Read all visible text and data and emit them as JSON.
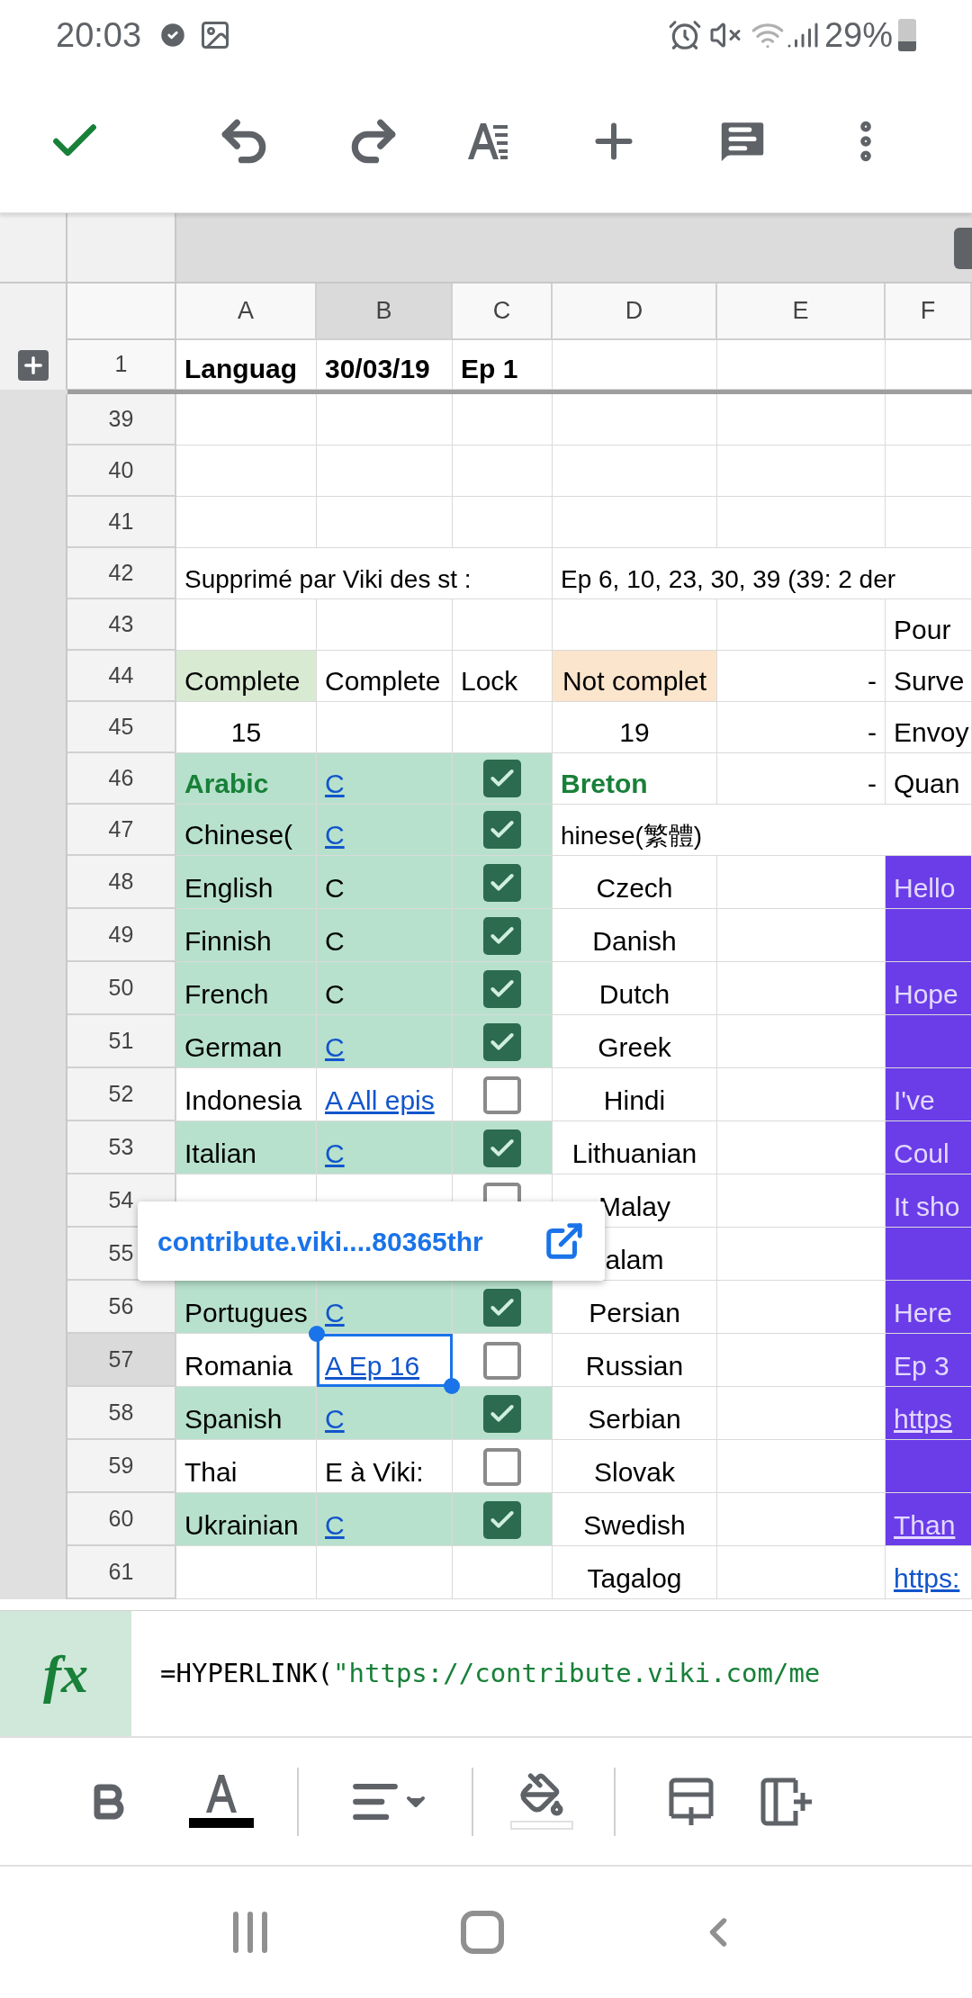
{
  "status_bar": {
    "time": "20:03",
    "battery": "29%"
  },
  "columns": [
    {
      "label": "A",
      "selected": false
    },
    {
      "label": "B",
      "selected": true
    },
    {
      "label": "C",
      "selected": false
    },
    {
      "label": "D",
      "selected": false
    },
    {
      "label": "E",
      "selected": false
    },
    {
      "label": "F",
      "selected": false
    }
  ],
  "frozen_row": {
    "number": "1",
    "cells": [
      {
        "text": "Languag",
        "kind": "header"
      },
      {
        "text": "30/03/19",
        "kind": "header"
      },
      {
        "text": "Ep 1",
        "kind": "header"
      }
    ]
  },
  "rows": [
    {
      "number": "39",
      "selected": false
    },
    {
      "number": "40",
      "selected": false
    },
    {
      "number": "41",
      "selected": false
    },
    {
      "number": "42",
      "selected": false,
      "cells": [
        {
          "text": "Supprimé par Viki des st :",
          "kind": "overflow"
        },
        {},
        {},
        {
          "text": "Ep 6, 10, 23, 30, 39 (39: 2 der",
          "kind": "overflow"
        }
      ]
    },
    {
      "number": "43",
      "selected": false,
      "cells": [
        {},
        {},
        {},
        {},
        {},
        {
          "text": "Pour",
          "kind": "text"
        }
      ]
    },
    {
      "number": "44",
      "selected": false,
      "cells": [
        {
          "text": "Complete",
          "kind": "text",
          "color": "#d9ead3"
        },
        {
          "text": "Complete",
          "kind": "text"
        },
        {
          "text": "Lock",
          "kind": "text"
        },
        {
          "text": "Not complet",
          "kind": "centered",
          "color": "#fce5cd"
        },
        {
          "text": "-",
          "kind": "dash"
        },
        {
          "text": "Surve",
          "kind": "text"
        }
      ]
    },
    {
      "number": "45",
      "selected": false,
      "cells": [
        {
          "text": "15",
          "kind": "number"
        },
        {},
        {},
        {
          "text": "19",
          "kind": "number"
        },
        {
          "text": "-",
          "kind": "dash"
        },
        {
          "text": "Envoy",
          "kind": "text"
        }
      ]
    },
    {
      "number": "46",
      "selected": false,
      "cells": [
        {
          "text": "Arabic",
          "kind": "title",
          "color": "#b7e1cd"
        },
        {
          "text": "C",
          "kind": "link",
          "color": "#b7e1cd"
        },
        {
          "kind": "checkbox",
          "checked": true,
          "color": "#b7e1cd"
        },
        {
          "text": "Breton",
          "kind": "title"
        },
        {
          "text": "-",
          "kind": "dash"
        },
        {
          "text": "Quan",
          "kind": "text"
        }
      ]
    },
    {
      "number": "47",
      "selected": false,
      "cells": [
        {
          "text": "Chinese(",
          "kind": "text",
          "color": "#b7e1cd"
        },
        {
          "text": "C",
          "kind": "link",
          "color": "#b7e1cd"
        },
        {
          "kind": "checkbox",
          "checked": true,
          "color": "#b7e1cd"
        },
        {
          "text": "hinese(繁體)",
          "kind": "overflow"
        }
      ]
    },
    {
      "number": "48",
      "selected": false,
      "cells": [
        {
          "text": "English",
          "kind": "text",
          "color": "#b7e1cd"
        },
        {
          "text": "C",
          "kind": "text",
          "color": "#b7e1cd"
        },
        {
          "kind": "checkbox",
          "checked": true,
          "color": "#b7e1cd"
        },
        {
          "text": "Czech",
          "kind": "centered"
        },
        {},
        {
          "text": "Hello",
          "kind": "text",
          "color": "#6a3de8"
        }
      ]
    },
    {
      "number": "49",
      "selected": false,
      "cells": [
        {
          "text": "Finnish",
          "kind": "text",
          "color": "#b7e1cd"
        },
        {
          "text": "C",
          "kind": "text",
          "color": "#b7e1cd"
        },
        {
          "kind": "checkbox",
          "checked": true,
          "color": "#b7e1cd"
        },
        {
          "text": "Danish",
          "kind": "centered"
        },
        {},
        {
          "kind": "text",
          "color": "#6a3de8"
        }
      ]
    },
    {
      "number": "50",
      "selected": false,
      "cells": [
        {
          "text": "French",
          "kind": "text",
          "color": "#b7e1cd"
        },
        {
          "text": "C",
          "kind": "text",
          "color": "#b7e1cd"
        },
        {
          "kind": "checkbox",
          "checked": true,
          "color": "#b7e1cd"
        },
        {
          "text": "Dutch",
          "kind": "centered"
        },
        {},
        {
          "text": "Hope",
          "kind": "text",
          "color": "#6a3de8"
        }
      ]
    },
    {
      "number": "51",
      "selected": false,
      "cells": [
        {
          "text": "German",
          "kind": "text",
          "color": "#b7e1cd"
        },
        {
          "text": "C",
          "kind": "link",
          "color": "#b7e1cd"
        },
        {
          "kind": "checkbox",
          "checked": true,
          "color": "#b7e1cd"
        },
        {
          "text": "Greek",
          "kind": "centered"
        },
        {},
        {
          "kind": "text",
          "color": "#6a3de8"
        }
      ]
    },
    {
      "number": "52",
      "selected": false,
      "cells": [
        {
          "text": "Indonesia",
          "kind": "text"
        },
        {
          "text": "A All epis",
          "kind": "link"
        },
        {
          "kind": "checkbox",
          "checked": false
        },
        {
          "text": "Hindi",
          "kind": "centered"
        },
        {},
        {
          "text": "I've",
          "kind": "text",
          "color": "#6a3de8"
        }
      ]
    },
    {
      "number": "53",
      "selected": false,
      "cells": [
        {
          "text": "Italian",
          "kind": "text",
          "color": "#b7e1cd"
        },
        {
          "text": "C",
          "kind": "link",
          "color": "#b7e1cd"
        },
        {
          "kind": "checkbox",
          "checked": true,
          "color": "#b7e1cd"
        },
        {
          "text": "Lithuanian",
          "kind": "centered"
        },
        {},
        {
          "text": "Coul",
          "kind": "text",
          "color": "#6a3de8"
        }
      ]
    },
    {
      "number": "54",
      "selected": false,
      "cells": [
        {},
        {},
        {
          "kind": "checkbox",
          "checked": false
        },
        {
          "text": "Malay",
          "kind": "centered"
        },
        {},
        {
          "text": "It sho",
          "kind": "text",
          "color": "#6a3de8"
        }
      ]
    },
    {
      "number": "55",
      "selected": false,
      "cells": [
        {
          "kind": "covered"
        },
        {
          "kind": "covered"
        },
        {
          "kind": "covered"
        },
        {
          "text": "alam",
          "kind": "centered"
        },
        {},
        {
          "kind": "text",
          "color": "#6a3de8"
        }
      ]
    },
    {
      "number": "56",
      "selected": false,
      "cells": [
        {
          "text": "Portugues",
          "kind": "text",
          "color": "#b7e1cd"
        },
        {
          "text": "C",
          "kind": "link",
          "color": "#b7e1cd"
        },
        {
          "kind": "checkbox",
          "checked": true,
          "color": "#b7e1cd"
        },
        {
          "text": "Persian",
          "kind": "centered"
        },
        {},
        {
          "text": "Here",
          "kind": "text",
          "color": "#6a3de8"
        }
      ]
    },
    {
      "number": "57",
      "selected": true,
      "cells": [
        {
          "text": "Romania",
          "kind": "text"
        },
        {
          "text": "A Ep 16",
          "kind": "link"
        },
        {
          "kind": "checkbox",
          "checked": false
        },
        {
          "text": "Russian",
          "kind": "centered"
        },
        {},
        {
          "text": "Ep 3",
          "kind": "text",
          "color": "#6a3de8"
        }
      ]
    },
    {
      "number": "58",
      "selected": false,
      "cells": [
        {
          "text": "Spanish",
          "kind": "text",
          "color": "#b7e1cd"
        },
        {
          "text": "C",
          "kind": "link",
          "color": "#b7e1cd"
        },
        {
          "kind": "checkbox",
          "checked": true,
          "color": "#b7e1cd"
        },
        {
          "text": "Serbian",
          "kind": "centered"
        },
        {},
        {
          "text": "https",
          "kind": "link",
          "color": "#6a3de8"
        }
      ]
    },
    {
      "number": "59",
      "selected": false,
      "cells": [
        {
          "text": "Thai",
          "kind": "text"
        },
        {
          "text": "E à Viki:",
          "kind": "text"
        },
        {
          "kind": "checkbox",
          "checked": false
        },
        {
          "text": "Slovak",
          "kind": "centered"
        },
        {},
        {
          "kind": "text",
          "color": "#6a3de8"
        }
      ]
    },
    {
      "number": "60",
      "selected": false,
      "cells": [
        {
          "text": "Ukrainian",
          "kind": "text",
          "color": "#b7e1cd"
        },
        {
          "text": "C",
          "kind": "link",
          "color": "#b7e1cd"
        },
        {
          "kind": "checkbox",
          "checked": true,
          "color": "#b7e1cd"
        },
        {
          "text": "Swedish",
          "kind": "centered"
        },
        {},
        {
          "text": "Than",
          "kind": "link",
          "color": "#6a3de8"
        }
      ]
    },
    {
      "number": "61",
      "selected": false,
      "cells": [
        {},
        {},
        {},
        {
          "text": "Tagalog",
          "kind": "centered"
        },
        {},
        {
          "text": "https:",
          "kind": "link"
        }
      ]
    }
  ],
  "link_popup": {
    "url": "contribute.viki....80365thr"
  },
  "formula_bar": {
    "label": "fx",
    "function": "=HYPERLINK(",
    "argument": "\"https://contribute.viki.com/me"
  }
}
